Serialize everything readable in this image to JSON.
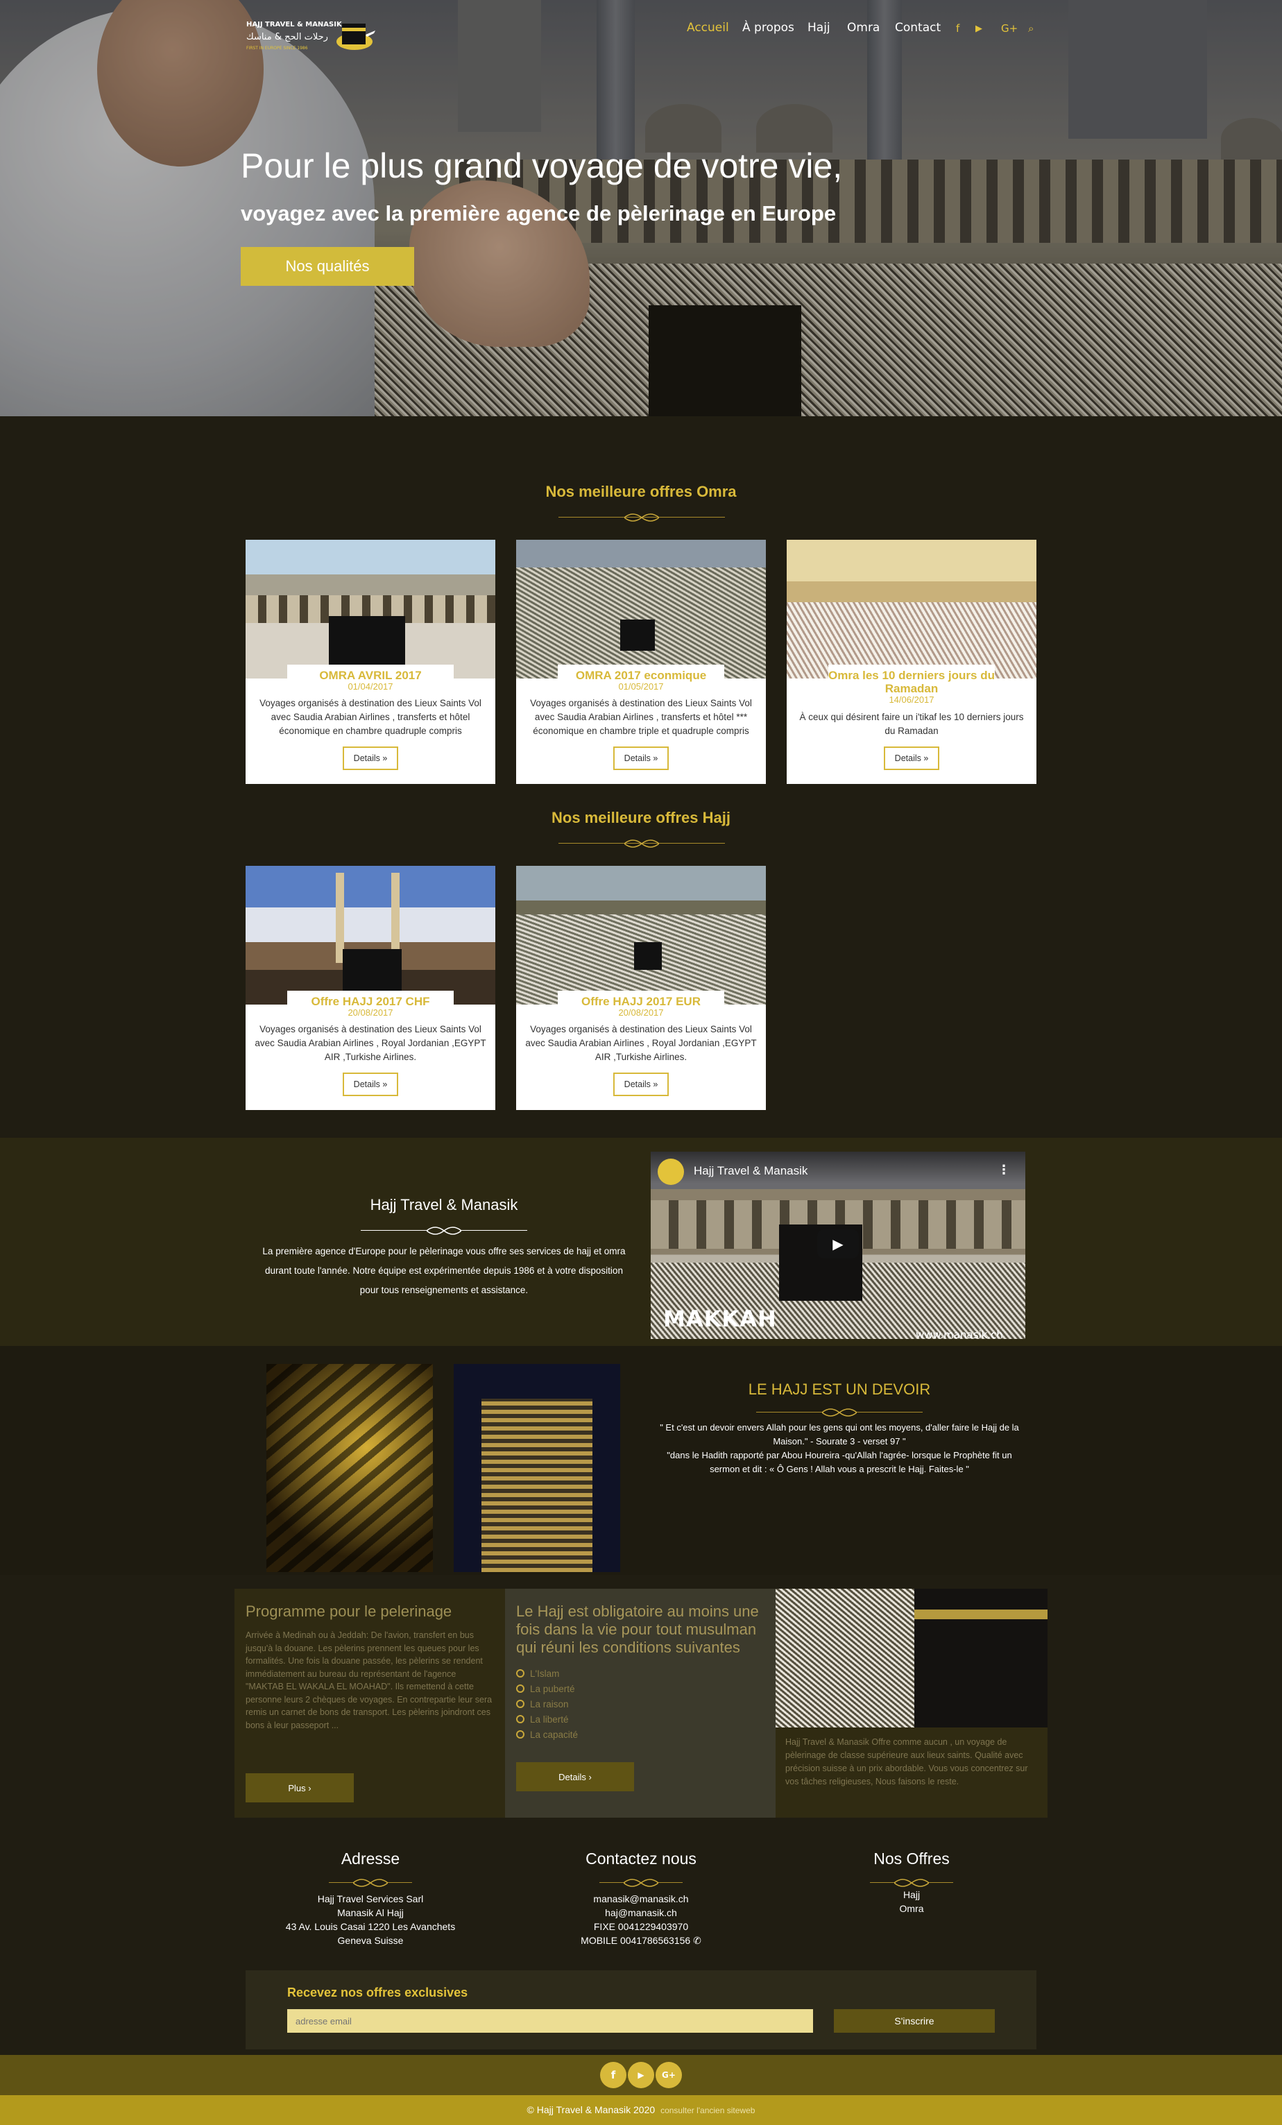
{
  "brand": {
    "name_top": "HAJJ TRAVEL & MANASIK",
    "name_arabic": "رحلات الحج & مناسك",
    "tagline": "FIRST IN EUROPE SINCE 1986"
  },
  "nav": {
    "items": [
      {
        "label": "Accueil",
        "active": true
      },
      {
        "label": "À propos"
      },
      {
        "label": "Hajj"
      },
      {
        "label": "Omra"
      },
      {
        "label": "Contact"
      }
    ],
    "icons": [
      "facebook-icon",
      "youtube-icon",
      "google-plus-icon",
      "search-icon"
    ],
    "icon_glyphs": [
      "f",
      "▶",
      "G+",
      "⌕"
    ]
  },
  "hero": {
    "title": "Pour le plus grand voyage de votre vie,",
    "subtitle": "voyagez avec la première agence de pèlerinage en Europe",
    "button": "Nos qualités"
  },
  "omra": {
    "heading": "Nos meilleure offres Omra",
    "cards": [
      {
        "title": "OMRA AVRIL 2017",
        "date": "01/04/2017",
        "desc": "Voyages organisés à destination des Lieux Saints Vol avec Saudia Arabian Airlines , transferts et hôtel économique en chambre  quadruple compris",
        "button": "Details »"
      },
      {
        "title": "OMRA 2017 econmique",
        "date": "01/05/2017",
        "desc": "Voyages organisés à destination des Lieux Saints Vol avec Saudia Arabian Airlines , transferts et hôtel *** économique en chambre triple et quadruple compris",
        "button": "Details »"
      },
      {
        "title": "Omra les 10 derniers jours du Ramadan",
        "date": "14/06/2017",
        "desc": "À ceux qui désirent faire un i'tikaf les 10 derniers jours du Ramadan",
        "button": "Details »"
      }
    ]
  },
  "hajj": {
    "heading": "Nos meilleure offres Hajj",
    "cards": [
      {
        "title": "Offre HAJJ 2017 CHF",
        "date": "20/08/2017",
        "desc": "Voyages organisés à destination des Lieux Saints Vol avec Saudia Arabian Airlines  , Royal Jordanian ,EGYPT AIR ,Turkishe Airlines.",
        "button": "Details »"
      },
      {
        "title": "Offre HAJJ 2017 EUR",
        "date": "20/08/2017",
        "desc": "Voyages organisés à destination des Lieux Saints Vol avec Saudia Arabian Airlines  , Royal Jordanian ,EGYPT AIR ,Turkishe Airlines.",
        "button": "Details »"
      }
    ]
  },
  "about": {
    "title": "Hajj Travel & Manasik",
    "text": "La première agence d'Europe pour le pèlerinage vous offre ses services de hajj et omra durant toute l'année. Notre équipe est expérimentée depuis 1986 et à votre disposition pour tous renseignements et assistance.",
    "video": {
      "channel": "Hajj Travel & Manasik",
      "overlay": "MAKKAH",
      "url_text": "www.manasik.ch"
    }
  },
  "duty": {
    "title": "LE HAJJ EST UN DEVOIR",
    "quote1": "\" Et c'est un devoir envers Allah pour les gens qui ont les moyens, d'aller faire le Hajj de la Maison.\" - Sourate 3 - verset 97 \"",
    "quote2": "\"dans le Hadith rapporté par Abou Houreira -qu'Allah l'agrée- lorsque le Prophète fit un sermon et dit : « Ô Gens ! Allah vous a prescrit le Hajj. Faites-le \""
  },
  "programme": {
    "title": "Programme pour le pelerinage",
    "text": "Arrivée à Medinah ou à Jeddah: De l'avion, transfert en bus jusqu'à la douane. Les pèlerins prennent les queues pour les formalités. Une fois la douane passée, les pèlerins se rendent immédiatement au bureau du représentant de l'agence \"MAKTAB EL WAKALA EL MOAHAD\". Ils remettend à cette personne leurs 2 chèques de voyages. En contrepartie leur sera remis un carnet de bons de transport. Les pèlerins joindront ces bons à leur passeport ...",
    "button": "Plus ›"
  },
  "conditions": {
    "title": "Le Hajj est obligatoire au moins une fois dans la vie pour tout musulman qui réuni les conditions suivantes",
    "items": [
      "L'Islam",
      "La puberté",
      "La raison",
      "La liberté",
      "La capacité"
    ],
    "button": "Details ›"
  },
  "offer": {
    "text": "Hajj Travel & Manasik Offre comme aucun , un voyage de pèlerinage de classe supérieure aux lieux saints. Qualité avec précision suisse à un prix abordable. Vous vous concentrez sur vos tâches religieuses, Nous faisons le reste."
  },
  "footer": {
    "address": {
      "title": "Adresse",
      "lines": [
        "Hajj Travel Services Sarl",
        "Manasik Al Hajj",
        "43 Av. Louis Casai 1220 Les Avanchets",
        "Geneva Suisse"
      ]
    },
    "contact": {
      "title": "Contactez nous",
      "lines": [
        "manasik@manasik.ch",
        "haj@manasik.ch",
        "FIXE 0041229403970",
        "MOBILE 0041786563156 ✆"
      ]
    },
    "offers": {
      "title": "Nos Offres",
      "lines": [
        "Hajj",
        "Omra"
      ]
    },
    "newsletter": {
      "title": "Recevez nos offres exclusives",
      "placeholder": "adresse email",
      "button": "S'inscrire"
    },
    "social_glyphs": [
      "f",
      "▶",
      "G+"
    ],
    "copyright": "© Hajj Travel & Manasik 2020",
    "old_site": "consulter l'ancien siteweb"
  },
  "colors": {
    "gold": "#d8b93a",
    "dark": "#201d12",
    "olive": "#5f5314",
    "bar": "#b39a1c"
  }
}
